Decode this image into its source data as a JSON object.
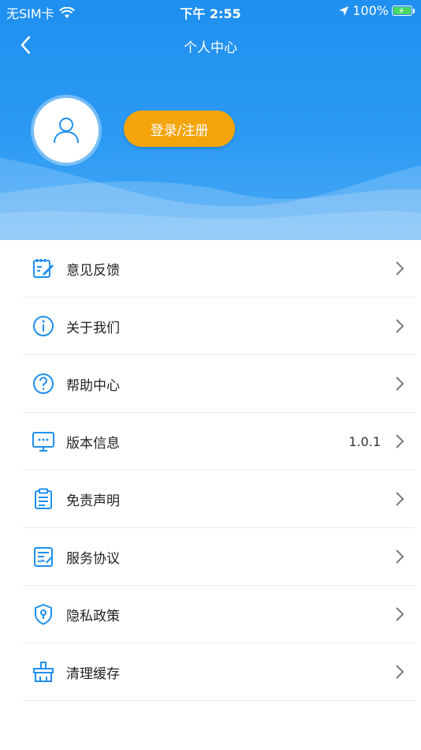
{
  "status": {
    "carrier": "无SIM卡",
    "time": "下午 2:55",
    "battery": "100%"
  },
  "nav": {
    "title": "个人中心"
  },
  "profile": {
    "login_label": "登录/注册"
  },
  "menu": [
    {
      "label": "意见反馈",
      "icon": "feedback-icon",
      "value": ""
    },
    {
      "label": "关于我们",
      "icon": "info-icon",
      "value": ""
    },
    {
      "label": "帮助中心",
      "icon": "help-icon",
      "value": ""
    },
    {
      "label": "版本信息",
      "icon": "version-icon",
      "value": "1.0.1"
    },
    {
      "label": "免责声明",
      "icon": "disclaimer-icon",
      "value": ""
    },
    {
      "label": "服务协议",
      "icon": "agreement-icon",
      "value": ""
    },
    {
      "label": "隐私政策",
      "icon": "privacy-icon",
      "value": ""
    },
    {
      "label": "清理缓存",
      "icon": "clear-cache-icon",
      "value": ""
    }
  ],
  "colors": {
    "header": "#1f8ff0",
    "accent": "#f5a40c",
    "icon": "#1f8ff0"
  }
}
